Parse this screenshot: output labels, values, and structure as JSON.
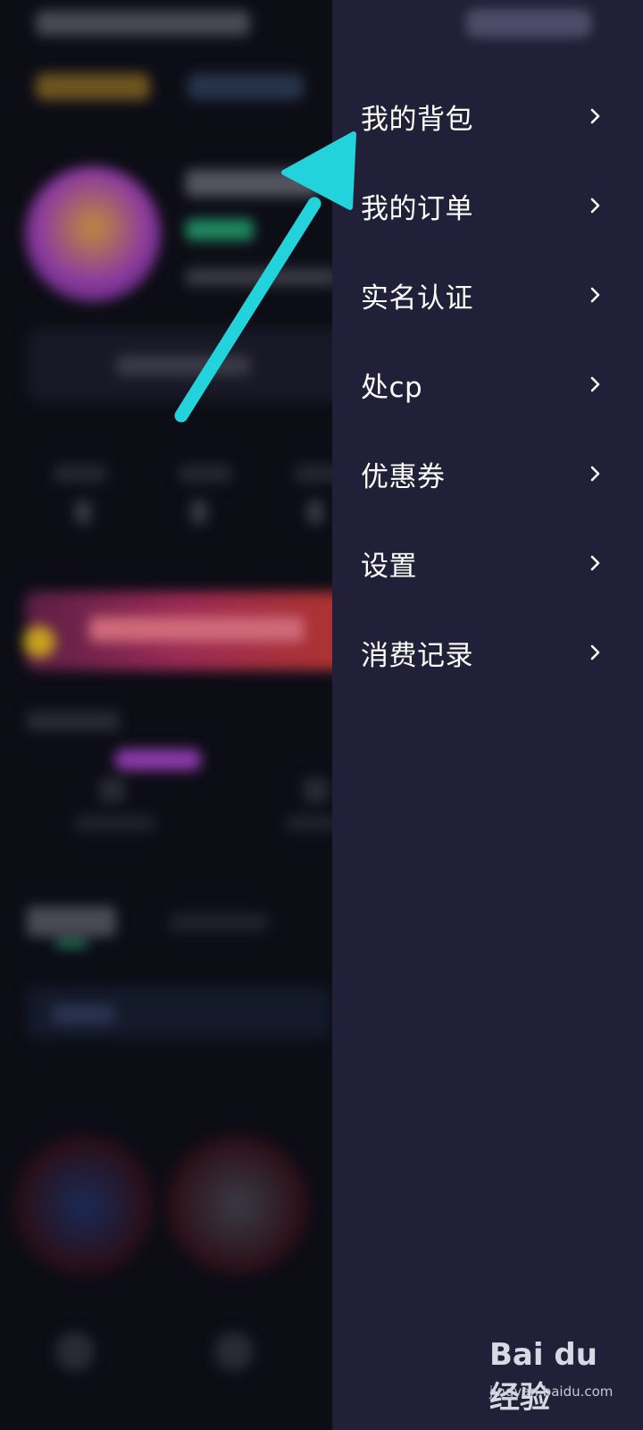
{
  "drawer": {
    "items": [
      {
        "label": "我的背包"
      },
      {
        "label": "我的订单"
      },
      {
        "label": "实名认证"
      },
      {
        "label": "处cp"
      },
      {
        "label": "优惠券"
      },
      {
        "label": "设置"
      },
      {
        "label": "消费记录"
      }
    ]
  },
  "colors": {
    "drawer_bg": "#222038",
    "arrow": "#22d3dc",
    "text": "#ffffff"
  },
  "icons": {
    "chevron": "chevron-right-icon",
    "annotation": "annotation-arrow-icon"
  },
  "watermark": {
    "logo": "Bai du 经验",
    "url": "jingyan.baidu.com"
  }
}
